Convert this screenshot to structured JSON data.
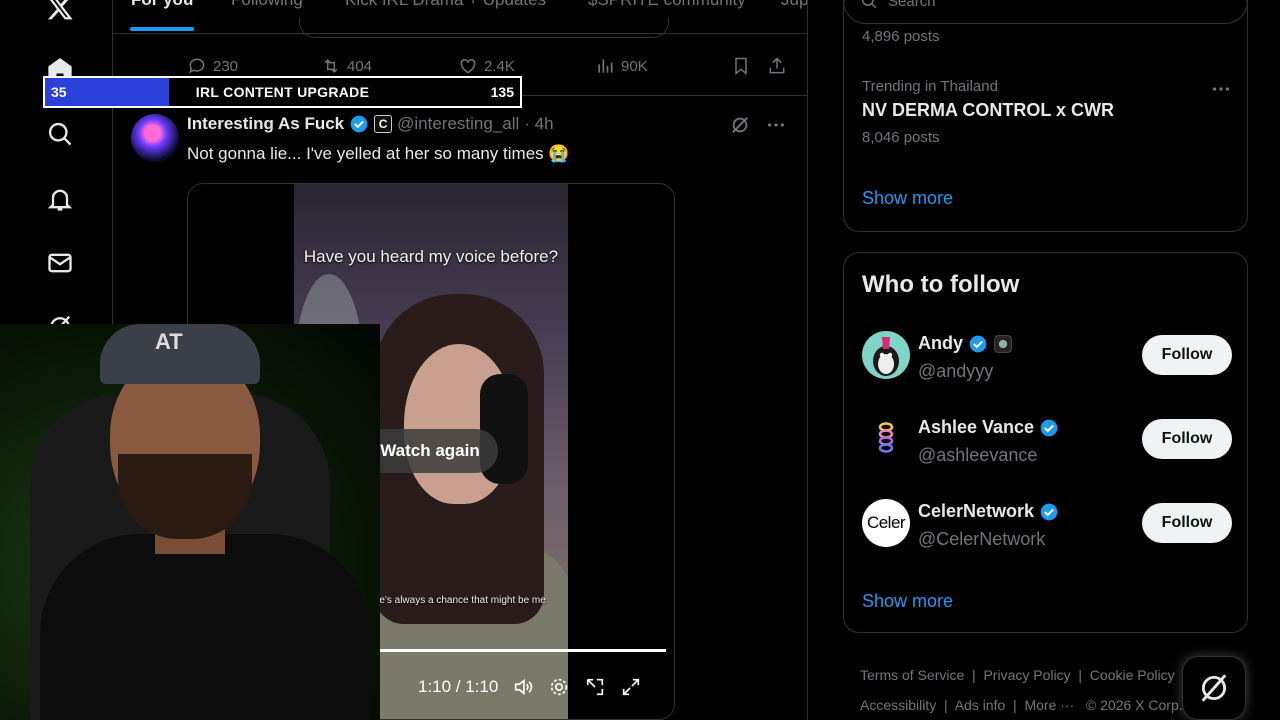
{
  "tabs": [
    "For you",
    "Following",
    "Kick IRL Drama + Updates",
    "$SPRITE community",
    "Jup"
  ],
  "actions": {
    "replies": "230",
    "reposts": "404",
    "likes": "2.4K",
    "views": "90K"
  },
  "post": {
    "author": "Interesting As Fuck",
    "handle": "@interesting_all",
    "time": "· 4h",
    "badge": "C",
    "text": "Not gonna lie... I've yelled at her so many times 😭",
    "video": {
      "overlay": "Have you heard my voice before?",
      "caption": "there's always a chance that might be me",
      "watch_again": "Watch again",
      "time": "1:10 / 1:10"
    }
  },
  "search": {
    "placeholder": "Search"
  },
  "trends": {
    "prev_count": "4,896 posts",
    "location": "Trending in Thailand",
    "title": "NV DERMA CONTROL x CWR",
    "count": "8,046 posts",
    "show_more": "Show more"
  },
  "who_to_follow": {
    "title": "Who to follow",
    "users": [
      {
        "name": "Andy",
        "handle": "@andyyy",
        "button": "Follow"
      },
      {
        "name": "Ashlee Vance",
        "handle": "@ashleevance",
        "button": "Follow"
      },
      {
        "name": "CelerNetwork",
        "handle": "@CelerNetwork",
        "button": "Follow",
        "avatar_text": "Celer"
      }
    ],
    "show_more": "Show more"
  },
  "footer": {
    "links": [
      "Terms of Service",
      "Privacy Policy",
      "Cookie Policy",
      "Accessibility",
      "Ads info",
      "More ···"
    ],
    "copyright": "© 2026 X Corp."
  },
  "stream_bar": {
    "current": "35",
    "title": "IRL CONTENT UPGRADE",
    "goal": "135",
    "progress_fraction": 0.26
  },
  "webcam": {
    "cap_logo": "AT"
  },
  "colors": {
    "accent": "#1d9bf0",
    "bar_fill": "#2b40d8"
  }
}
